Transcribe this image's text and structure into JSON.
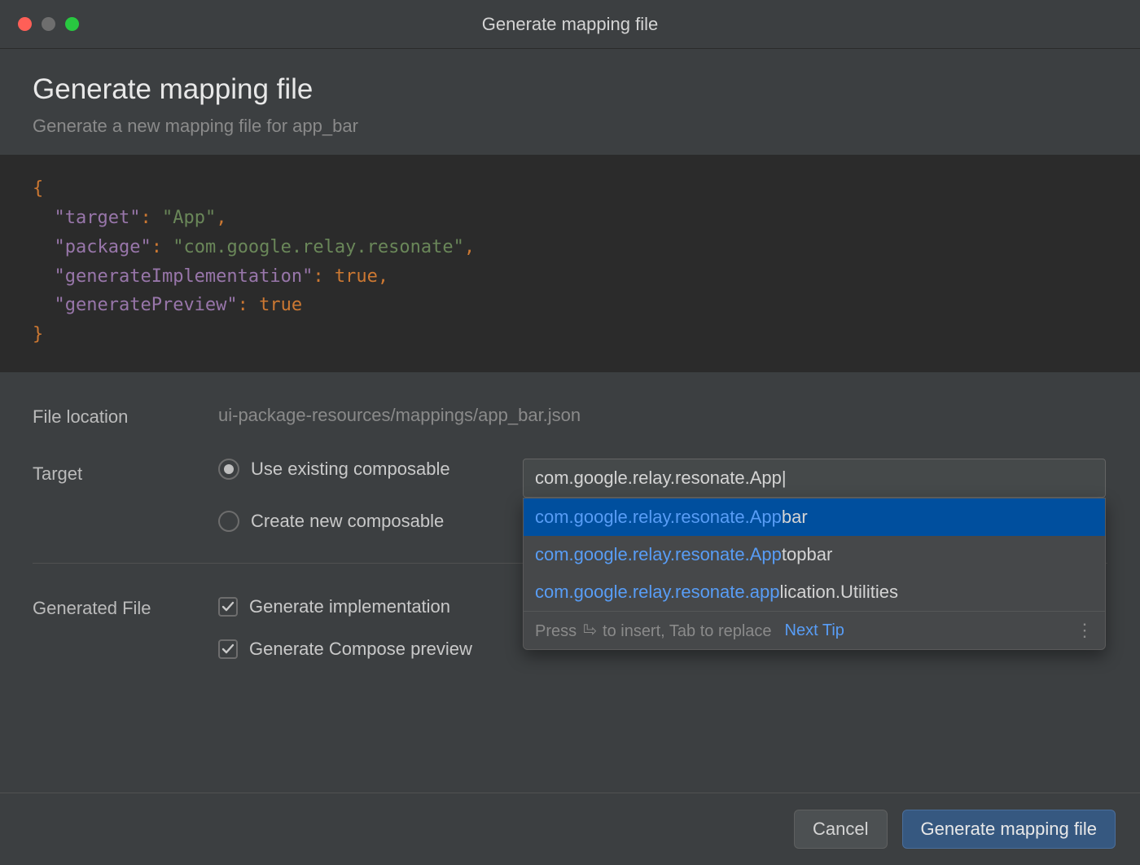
{
  "window": {
    "title": "Generate mapping file"
  },
  "header": {
    "title": "Generate mapping file",
    "subtitle": "Generate a new mapping file for app_bar"
  },
  "code": {
    "target_key": "\"target\"",
    "target_val": "\"App\"",
    "package_key": "\"package\"",
    "package_val": "\"com.google.relay.resonate\"",
    "genimpl_key": "\"generateImplementation\"",
    "genprev_key": "\"generatePreview\"",
    "true": "true"
  },
  "form": {
    "file_location_label": "File location",
    "file_location_value": "ui-package-resources/mappings/app_bar.json",
    "target_label": "Target",
    "radio_existing": "Use existing composable",
    "radio_new": "Create new composable",
    "target_input_value": "com.google.relay.resonate.App|",
    "generated_file_label": "Generated File",
    "check_impl": "Generate implementation",
    "check_preview": "Generate Compose preview"
  },
  "autocomplete": {
    "items": [
      {
        "match": "com.google.relay.resonate.App",
        "rest": "bar"
      },
      {
        "match": "com.google.relay.resonate.App",
        "rest": "topbar"
      },
      {
        "match": "com.google.relay.resonate.app",
        "rest": "lication.Utilities"
      }
    ],
    "hint_prefix": "Press ",
    "hint_suffix": " to insert, Tab to replace",
    "next_tip": "Next Tip"
  },
  "buttons": {
    "cancel": "Cancel",
    "generate": "Generate mapping file"
  }
}
